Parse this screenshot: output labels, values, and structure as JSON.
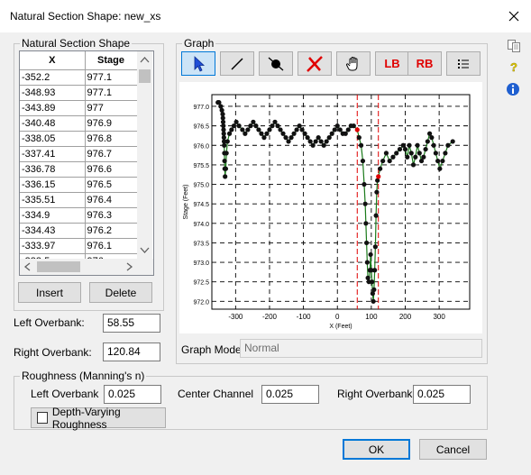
{
  "window": {
    "title": "Natural Section Shape: new_xs"
  },
  "section_group": {
    "label": "Natural Section Shape"
  },
  "table": {
    "headers": [
      "X",
      "Stage"
    ],
    "rows": [
      [
        "-352.2",
        "977.1"
      ],
      [
        "-348.93",
        "977.1"
      ],
      [
        "-343.89",
        "977"
      ],
      [
        "-340.48",
        "976.9"
      ],
      [
        "-338.05",
        "976.8"
      ],
      [
        "-337.41",
        "976.7"
      ],
      [
        "-336.78",
        "976.6"
      ],
      [
        "-336.15",
        "976.5"
      ],
      [
        "-335.51",
        "976.4"
      ],
      [
        "-334.9",
        "976.3"
      ],
      [
        "-334.43",
        "976.2"
      ],
      [
        "-333.97",
        "976.1"
      ],
      [
        "-333.5",
        "976"
      ]
    ]
  },
  "buttons": {
    "insert": "Insert",
    "delete": "Delete",
    "ok": "OK",
    "cancel": "Cancel"
  },
  "overbanks": {
    "left_label": "Left Overbank:",
    "left_value": "58.55",
    "right_label": "Right Overbank:",
    "right_value": "120.84"
  },
  "graph_group": {
    "label": "Graph"
  },
  "tools": [
    {
      "name": "select-arrow-icon"
    },
    {
      "name": "draw-line-icon"
    },
    {
      "name": "add-point-icon"
    },
    {
      "name": "delete-point-icon"
    },
    {
      "name": "pan-hand-icon"
    },
    {
      "name": "left-bank-tool",
      "text": "LB"
    },
    {
      "name": "right-bank-tool",
      "text": "RB"
    },
    {
      "name": "list-icon"
    }
  ],
  "graph_mode": {
    "label": "Graph Mode",
    "value": "Normal"
  },
  "roughness": {
    "group_label": "Roughness (Manning's n)",
    "left_label": "Left Overbank",
    "left_value": "0.025",
    "center_label": "Center Channel",
    "center_value": "0.025",
    "right_label": "Right Overbank",
    "right_value": "0.025",
    "depth_varying_label": "Depth-Varying Roughness",
    "depth_varying_checked": false
  },
  "side_icons": [
    "copy-icon",
    "help-icon",
    "info-icon"
  ],
  "colors": {
    "line": "#1a7a1a",
    "point": "#111111",
    "bank_marker": "#e00000",
    "bank_line": "#e00000",
    "accent": "#0078d7"
  },
  "chart_data": {
    "type": "scatter",
    "xlabel": "X (Feet)",
    "ylabel": "Stage (Feet)",
    "xlim": [
      -370,
      390
    ],
    "ylim": [
      971.8,
      977.3
    ],
    "xticks": [
      -300,
      -200,
      -100,
      0,
      100,
      200,
      300
    ],
    "yticks": [
      972.0,
      972.5,
      973.0,
      973.5,
      974.0,
      974.5,
      975.0,
      975.5,
      976.0,
      976.5,
      977.0
    ],
    "grid": true,
    "series": [
      {
        "points": [
          [
            -352.2,
            977.1
          ],
          [
            -348.93,
            977.1
          ],
          [
            -343.89,
            977
          ],
          [
            -340.48,
            976.9
          ],
          [
            -338.05,
            976.8
          ],
          [
            -337.41,
            976.7
          ],
          [
            -336.78,
            976.6
          ],
          [
            -336.15,
            976.5
          ],
          [
            -335.51,
            976.4
          ],
          [
            -334.9,
            976.3
          ],
          [
            -334.43,
            976.2
          ],
          [
            -333.97,
            976.1
          ],
          [
            -333.5,
            976
          ],
          [
            -333,
            975.8
          ],
          [
            -332.5,
            975.6
          ],
          [
            -332,
            975.4
          ],
          [
            -331,
            975.2
          ],
          [
            -329,
            975.4
          ],
          [
            -327,
            975.8
          ],
          [
            -324,
            976.1
          ],
          [
            -318,
            976.3
          ],
          [
            -312,
            976.4
          ],
          [
            -305,
            976.5
          ],
          [
            -298,
            976.6
          ],
          [
            -290,
            976.5
          ],
          [
            -280,
            976.4
          ],
          [
            -272,
            976.3
          ],
          [
            -264,
            976.4
          ],
          [
            -256,
            976.5
          ],
          [
            -248,
            976.6
          ],
          [
            -240,
            976.5
          ],
          [
            -232,
            976.4
          ],
          [
            -224,
            976.3
          ],
          [
            -216,
            976.2
          ],
          [
            -208,
            976.3
          ],
          [
            -200,
            976.4
          ],
          [
            -192,
            976.5
          ],
          [
            -184,
            976.6
          ],
          [
            -176,
            976.5
          ],
          [
            -168,
            976.4
          ],
          [
            -160,
            976.3
          ],
          [
            -152,
            976.2
          ],
          [
            -144,
            976.1
          ],
          [
            -136,
            976.2
          ],
          [
            -128,
            976.3
          ],
          [
            -120,
            976.4
          ],
          [
            -112,
            976.5
          ],
          [
            -104,
            976.4
          ],
          [
            -96,
            976.3
          ],
          [
            -88,
            976.2
          ],
          [
            -80,
            976.1
          ],
          [
            -72,
            976.0
          ],
          [
            -64,
            976.1
          ],
          [
            -56,
            976.2
          ],
          [
            -48,
            976.1
          ],
          [
            -40,
            976.0
          ],
          [
            -32,
            976.1
          ],
          [
            -24,
            976.2
          ],
          [
            -16,
            976.3
          ],
          [
            -8,
            976.4
          ],
          [
            0,
            976.5
          ],
          [
            8,
            976.4
          ],
          [
            16,
            976.3
          ],
          [
            24,
            976.3
          ],
          [
            32,
            976.4
          ],
          [
            40,
            976.5
          ],
          [
            48,
            976.5
          ],
          [
            58.55,
            976.4
          ],
          [
            64,
            976.2
          ],
          [
            70,
            976.0
          ],
          [
            75,
            975.6
          ],
          [
            79,
            975.0
          ],
          [
            82,
            974.5
          ],
          [
            84,
            974.0
          ],
          [
            86,
            973.5
          ],
          [
            88,
            973.0
          ],
          [
            90,
            972.6
          ],
          [
            93,
            972.5
          ],
          [
            96,
            972.8
          ],
          [
            98,
            973.2
          ],
          [
            100,
            972.8
          ],
          [
            102,
            972.5
          ],
          [
            104,
            972.2
          ],
          [
            106,
            972.0
          ],
          [
            108,
            972.3
          ],
          [
            110,
            972.8
          ],
          [
            112,
            973.4
          ],
          [
            114,
            974.2
          ],
          [
            116,
            974.8
          ],
          [
            118,
            975.1
          ],
          [
            120.84,
            975.2
          ],
          [
            126,
            975.4
          ],
          [
            134,
            975.6
          ],
          [
            144,
            975.8
          ],
          [
            154,
            975.6
          ],
          [
            164,
            975.7
          ],
          [
            174,
            975.8
          ],
          [
            184,
            975.9
          ],
          [
            194,
            976.0
          ],
          [
            200,
            975.9
          ],
          [
            206,
            975.7
          ],
          [
            212,
            976.0
          ],
          [
            218,
            975.8
          ],
          [
            224,
            975.5
          ],
          [
            230,
            975.7
          ],
          [
            236,
            976.0
          ],
          [
            242,
            975.8
          ],
          [
            248,
            975.6
          ],
          [
            254,
            975.7
          ],
          [
            260,
            975.9
          ],
          [
            266,
            976.1
          ],
          [
            272,
            976.3
          ],
          [
            278,
            976.2
          ],
          [
            284,
            976.0
          ],
          [
            290,
            975.8
          ],
          [
            296,
            975.6
          ],
          [
            302,
            975.4
          ],
          [
            310,
            975.6
          ],
          [
            318,
            975.8
          ],
          [
            326,
            976.0
          ],
          [
            340,
            976.1
          ]
        ]
      }
    ],
    "banks": [
      {
        "label": "LB",
        "x": 58.55
      },
      {
        "label": "RB",
        "x": 120.84
      }
    ]
  }
}
